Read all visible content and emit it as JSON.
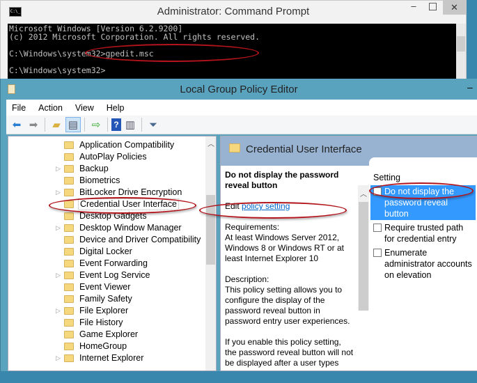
{
  "cmd": {
    "title": "Administrator: Command Prompt",
    "icon": "console-icon",
    "lines": [
      "Microsoft Windows [Version 6.2.9200]",
      "(c) 2012 Microsoft Corporation. All rights reserved.",
      "",
      "C:\\Windows\\system32>gpedit.msc",
      "",
      "C:\\Windows\\system32>"
    ],
    "minimize": "–",
    "maximize": "☐",
    "close": "✕"
  },
  "gpe": {
    "title": "Local Group Policy Editor",
    "minimize": "–",
    "menu": [
      "File",
      "Action",
      "View",
      "Help"
    ],
    "toolbar": [
      "back-icon",
      "forward-icon",
      "up-folder-icon",
      "show-hide-tree-icon",
      "export-list-icon",
      "help-icon",
      "show-hide-action-pane-icon",
      "filter-icon"
    ],
    "tree": [
      {
        "label": "Application Compatibility",
        "expandable": false
      },
      {
        "label": "AutoPlay Policies",
        "expandable": false
      },
      {
        "label": "Backup",
        "expandable": true
      },
      {
        "label": "Biometrics",
        "expandable": false
      },
      {
        "label": "BitLocker Drive Encryption",
        "expandable": true
      },
      {
        "label": "Credential User Interface",
        "expandable": false,
        "selected": true
      },
      {
        "label": "Desktop Gadgets",
        "expandable": false
      },
      {
        "label": "Desktop Window Manager",
        "expandable": true
      },
      {
        "label": "Device and Driver Compatibility",
        "expandable": false
      },
      {
        "label": "Digital Locker",
        "expandable": false
      },
      {
        "label": "Event Forwarding",
        "expandable": false
      },
      {
        "label": "Event Log Service",
        "expandable": true
      },
      {
        "label": "Event Viewer",
        "expandable": false
      },
      {
        "label": "Family Safety",
        "expandable": false
      },
      {
        "label": "File Explorer",
        "expandable": true
      },
      {
        "label": "File History",
        "expandable": false
      },
      {
        "label": "Game Explorer",
        "expandable": false
      },
      {
        "label": "HomeGroup",
        "expandable": false
      },
      {
        "label": "Internet Explorer",
        "expandable": true
      }
    ],
    "right": {
      "header": "Credential User Interface",
      "desc": {
        "title": "Do not display the password reveal button",
        "edit_prefix": "Edit ",
        "edit_link": "policy setting ",
        "requirements": "Requirements:\nAt least Windows Server 2012, Windows 8 or Windows RT or at least Internet Explorer 10",
        "description": "Description:\nThis policy setting allows you to configure the display of the password reveal button in password entry user experiences.",
        "enable": "If you enable this policy setting, the password reveal button will not be displayed after a user types"
      },
      "list_header": "Setting",
      "settings": [
        "Do not display the password reveal button",
        "Require trusted path for credential entry",
        "Enumerate administrator accounts on elevation"
      ]
    }
  },
  "colors": {
    "annotation": "#b3141b",
    "selection": "#3399ff",
    "header_band": "#98b3d1"
  }
}
